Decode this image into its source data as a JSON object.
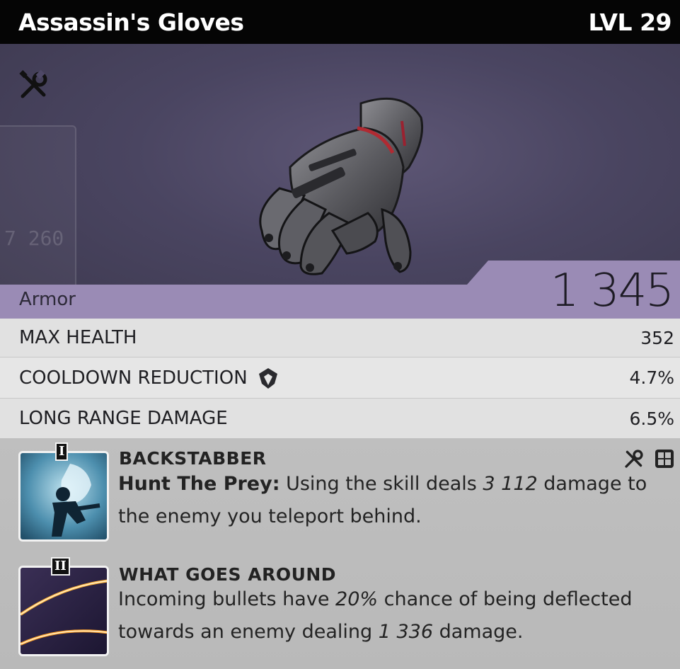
{
  "header": {
    "item_name": "Assassin's Gloves",
    "level": "LVL 29"
  },
  "hero": {
    "background_number": "7 260",
    "mod_icon": "wrench-screwdriver-icon"
  },
  "armor": {
    "label": "Armor",
    "value": "1 345"
  },
  "stats": [
    {
      "name": "MAX HEALTH",
      "value": "352",
      "icon": null
    },
    {
      "name": "COOLDOWN REDUCTION",
      "value": "4.7%",
      "icon": "faction-emblem-icon"
    },
    {
      "name": "LONG RANGE DAMAGE",
      "value": "6.5%"
    }
  ],
  "perks": [
    {
      "tier": "I",
      "name": "BACKSTABBER",
      "desc_lead": "Hunt The Prey:",
      "desc_part1": " Using the skill deals ",
      "desc_value1": "3 112",
      "desc_part2": " damage to the enemy you teleport behind.",
      "icons": [
        "wrench-screwdriver-icon",
        "grid-icon"
      ]
    },
    {
      "tier": "II",
      "name": "WHAT GOES AROUND",
      "desc_part1": "Incoming bullets have ",
      "desc_value1": "20%",
      "desc_part2": " chance of being deflected towards an enemy dealing ",
      "desc_value2": "1 336",
      "desc_part3": " damage."
    }
  ],
  "colors": {
    "header_bg": "#050505",
    "hero_bg": "#4a4561",
    "armor_band": "#9a8bb5",
    "stat_row": "#e1e1e1",
    "perk_bg": "#bdbdbd"
  }
}
